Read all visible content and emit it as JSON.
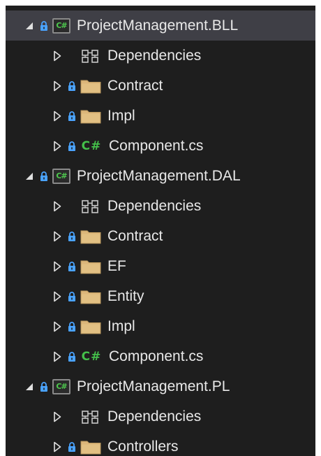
{
  "tree": [
    {
      "kind": "project",
      "label": "ProjectManagement.BLL",
      "icon": "csharp-project-icon",
      "expanded": true,
      "selected": true
    },
    {
      "kind": "dependencies",
      "label": "Dependencies",
      "icon": "dependencies-icon",
      "expanded": false
    },
    {
      "kind": "folder",
      "label": "Contract",
      "icon": "folder-icon",
      "expanded": false
    },
    {
      "kind": "folder",
      "label": "Impl",
      "icon": "folder-icon",
      "expanded": false
    },
    {
      "kind": "file",
      "label": "Component.cs",
      "icon": "csharp-file-icon",
      "expanded": false
    },
    {
      "kind": "project",
      "label": "ProjectManagement.DAL",
      "icon": "csharp-project-icon",
      "expanded": true
    },
    {
      "kind": "dependencies",
      "label": "Dependencies",
      "icon": "dependencies-icon",
      "expanded": false
    },
    {
      "kind": "folder",
      "label": "Contract",
      "icon": "folder-icon",
      "expanded": false
    },
    {
      "kind": "folder",
      "label": "EF",
      "icon": "folder-icon",
      "expanded": false
    },
    {
      "kind": "folder",
      "label": "Entity",
      "icon": "folder-icon",
      "expanded": false
    },
    {
      "kind": "folder",
      "label": "Impl",
      "icon": "folder-icon",
      "expanded": false
    },
    {
      "kind": "file",
      "label": "Component.cs",
      "icon": "csharp-file-icon",
      "expanded": false
    },
    {
      "kind": "project",
      "label": "ProjectManagement.PL",
      "icon": "csharp-project-icon",
      "expanded": true
    },
    {
      "kind": "dependencies",
      "label": "Dependencies",
      "icon": "dependencies-icon",
      "expanded": false
    },
    {
      "kind": "folder",
      "label": "Controllers",
      "icon": "folder-icon",
      "expanded": false
    }
  ],
  "project_badge_text": "C#",
  "file_badge_text": "C#",
  "colors": {
    "background": "#1e1e1e",
    "selected_row": "#3f3f46",
    "text": "#e8e8e8",
    "lock": "#4aa3ff",
    "folder": "#dcb67a",
    "csharp_green": "#44c04a"
  }
}
